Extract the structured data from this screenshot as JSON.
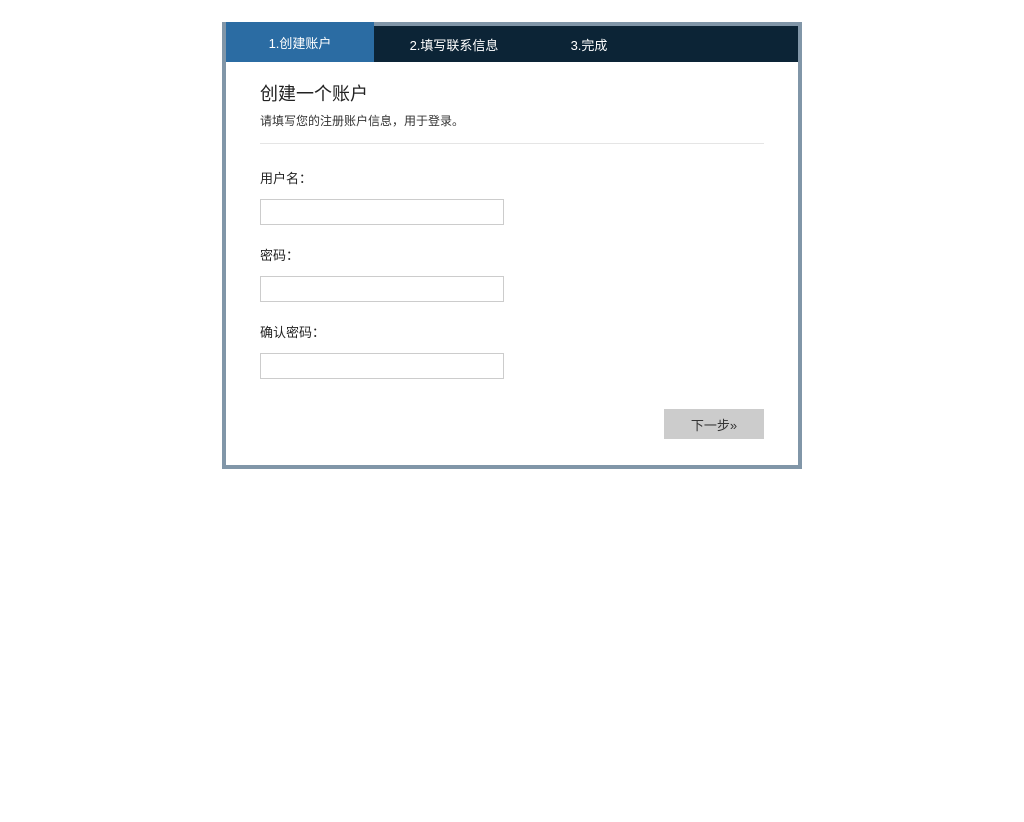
{
  "tabs": {
    "tab1": "1.创建账户",
    "tab2": "2.填写联系信息",
    "tab3": "3.完成"
  },
  "page": {
    "title": "创建一个账户",
    "subtitle": "请填写您的注册账户信息，用于登录。"
  },
  "form": {
    "username_label": "用户名：",
    "username_value": "",
    "password_label": "密码：",
    "password_value": "",
    "confirm_password_label": "确认密码：",
    "confirm_password_value": ""
  },
  "buttons": {
    "next": "下一步»"
  }
}
